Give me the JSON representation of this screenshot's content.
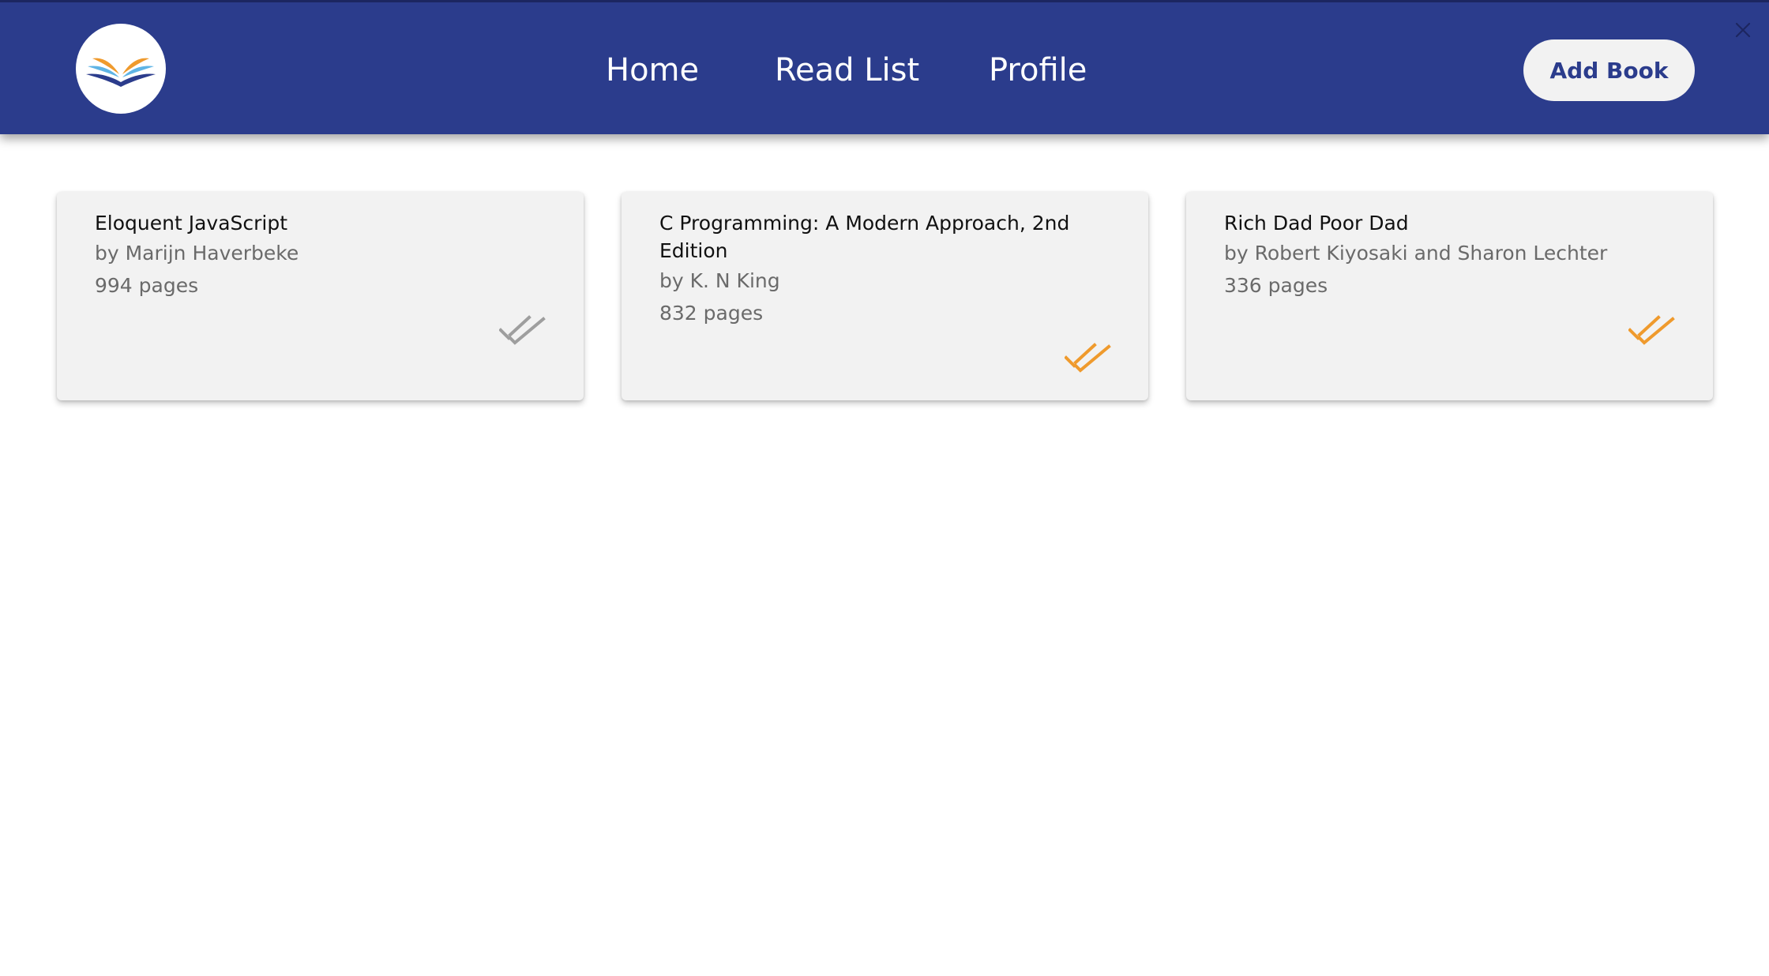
{
  "header": {
    "nav": [
      {
        "label": "Home"
      },
      {
        "label": "Read List"
      },
      {
        "label": "Profile"
      }
    ],
    "add_book_label": "Add Book"
  },
  "books": [
    {
      "title": "Eloquent JavaScript",
      "author": "by Marijn Haverbeke",
      "pages": "994 pages",
      "read": false,
      "check_icon": "double-check-icon"
    },
    {
      "title": "C Programming: A Modern Approach, 2nd Edition",
      "author": "by K. N King",
      "pages": "832 pages",
      "read": true,
      "check_icon": "double-check-icon"
    },
    {
      "title": "Rich Dad Poor Dad",
      "author": "by Robert Kiyosaki and Sharon Lechter",
      "pages": "336 pages",
      "read": true,
      "check_icon": "double-check-icon"
    }
  ],
  "colors": {
    "header_bg": "#2b3c8c",
    "read_check": "#ef9a2d",
    "unread_check": "#9e9e9e",
    "card_bg": "#f2f2f2"
  }
}
